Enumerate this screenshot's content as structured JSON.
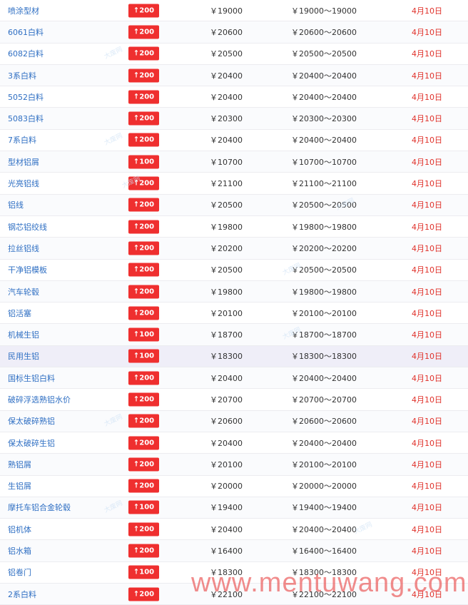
{
  "table": {
    "rows": [
      {
        "name": "喷涂型材",
        "change": "↑200",
        "price": "￥19000",
        "range": "￥19000～19000",
        "date": "4月10日"
      },
      {
        "name": "6061白料",
        "change": "↑200",
        "price": "￥20600",
        "range": "￥20600～20600",
        "date": "4月10日"
      },
      {
        "name": "6082白料",
        "change": "↑200",
        "price": "￥20500",
        "range": "￥20500～20500",
        "date": "4月10日"
      },
      {
        "name": "3系白料",
        "change": "↑200",
        "price": "￥20400",
        "range": "￥20400～20400",
        "date": "4月10日"
      },
      {
        "name": "5052白料",
        "change": "↑200",
        "price": "￥20400",
        "range": "￥20400～20400",
        "date": "4月10日"
      },
      {
        "name": "5083白料",
        "change": "↑200",
        "price": "￥20300",
        "range": "￥20300～20300",
        "date": "4月10日"
      },
      {
        "name": "7系白料",
        "change": "↑200",
        "price": "￥20400",
        "range": "￥20400～20400",
        "date": "4月10日"
      },
      {
        "name": "型材铝屑",
        "change": "↑100",
        "price": "￥10700",
        "range": "￥10700～10700",
        "date": "4月10日"
      },
      {
        "name": "光亮铝线",
        "change": "↑200",
        "price": "￥21100",
        "range": "￥21100～21100",
        "date": "4月10日"
      },
      {
        "name": "铝线",
        "change": "↑200",
        "price": "￥20500",
        "range": "￥20500～20500",
        "date": "4月10日"
      },
      {
        "name": "钢芯铝绞线",
        "change": "↑200",
        "price": "￥19800",
        "range": "￥19800～19800",
        "date": "4月10日"
      },
      {
        "name": "拉丝铝线",
        "change": "↑200",
        "price": "￥20200",
        "range": "￥20200～20200",
        "date": "4月10日"
      },
      {
        "name": "干净铝模板",
        "change": "↑200",
        "price": "￥20500",
        "range": "￥20500～20500",
        "date": "4月10日"
      },
      {
        "name": "汽车轮毂",
        "change": "↑200",
        "price": "￥19800",
        "range": "￥19800～19800",
        "date": "4月10日"
      },
      {
        "name": "铝活塞",
        "change": "↑200",
        "price": "￥20100",
        "range": "￥20100～20100",
        "date": "4月10日"
      },
      {
        "name": "机械生铝",
        "change": "↑100",
        "price": "￥18700",
        "range": "￥18700～18700",
        "date": "4月10日"
      },
      {
        "name": "民用生铝",
        "change": "↑100",
        "price": "￥18300",
        "range": "￥18300～18300",
        "date": "4月10日"
      },
      {
        "name": "国标生铝白料",
        "change": "↑200",
        "price": "￥20400",
        "range": "￥20400～20400",
        "date": "4月10日"
      },
      {
        "name": "破碎浮选熟铝水价",
        "change": "↑200",
        "price": "￥20700",
        "range": "￥20700～20700",
        "date": "4月10日"
      },
      {
        "name": "保太破碎熟铝",
        "change": "↑200",
        "price": "￥20600",
        "range": "￥20600～20600",
        "date": "4月10日"
      },
      {
        "name": "保太破碎生铝",
        "change": "↑200",
        "price": "￥20400",
        "range": "￥20400～20400",
        "date": "4月10日"
      },
      {
        "name": "熟铝屑",
        "change": "↑200",
        "price": "￥20100",
        "range": "￥20100～20100",
        "date": "4月10日"
      },
      {
        "name": "生铝屑",
        "change": "↑200",
        "price": "￥20000",
        "range": "￥20000～20000",
        "date": "4月10日"
      },
      {
        "name": "摩托车铝合金轮毂",
        "change": "↑100",
        "price": "￥19400",
        "range": "￥19400～19400",
        "date": "4月10日"
      },
      {
        "name": "铝机体",
        "change": "↑200",
        "price": "￥20400",
        "range": "￥20400～20400",
        "date": "4月10日"
      },
      {
        "name": "铝水箱",
        "change": "↑200",
        "price": "￥16400",
        "range": "￥16400～16400",
        "date": "4月10日"
      },
      {
        "name": "铝卷门",
        "change": "↑100",
        "price": "￥18300",
        "range": "￥18300～18300",
        "date": "4月10日"
      },
      {
        "name": "2系白料",
        "change": "↑200",
        "price": "￥22100",
        "range": "￥22100～22100",
        "date": "4月10日"
      }
    ]
  },
  "watermark": {
    "site": "www.mentuwang.com",
    "logo": "大废网"
  },
  "colors": {
    "link": "#2f6fc3",
    "badge_bg": "#ef2f2f",
    "date": "#e0312a",
    "highlight_row": "#efeef8",
    "watermark": "#e84646"
  }
}
